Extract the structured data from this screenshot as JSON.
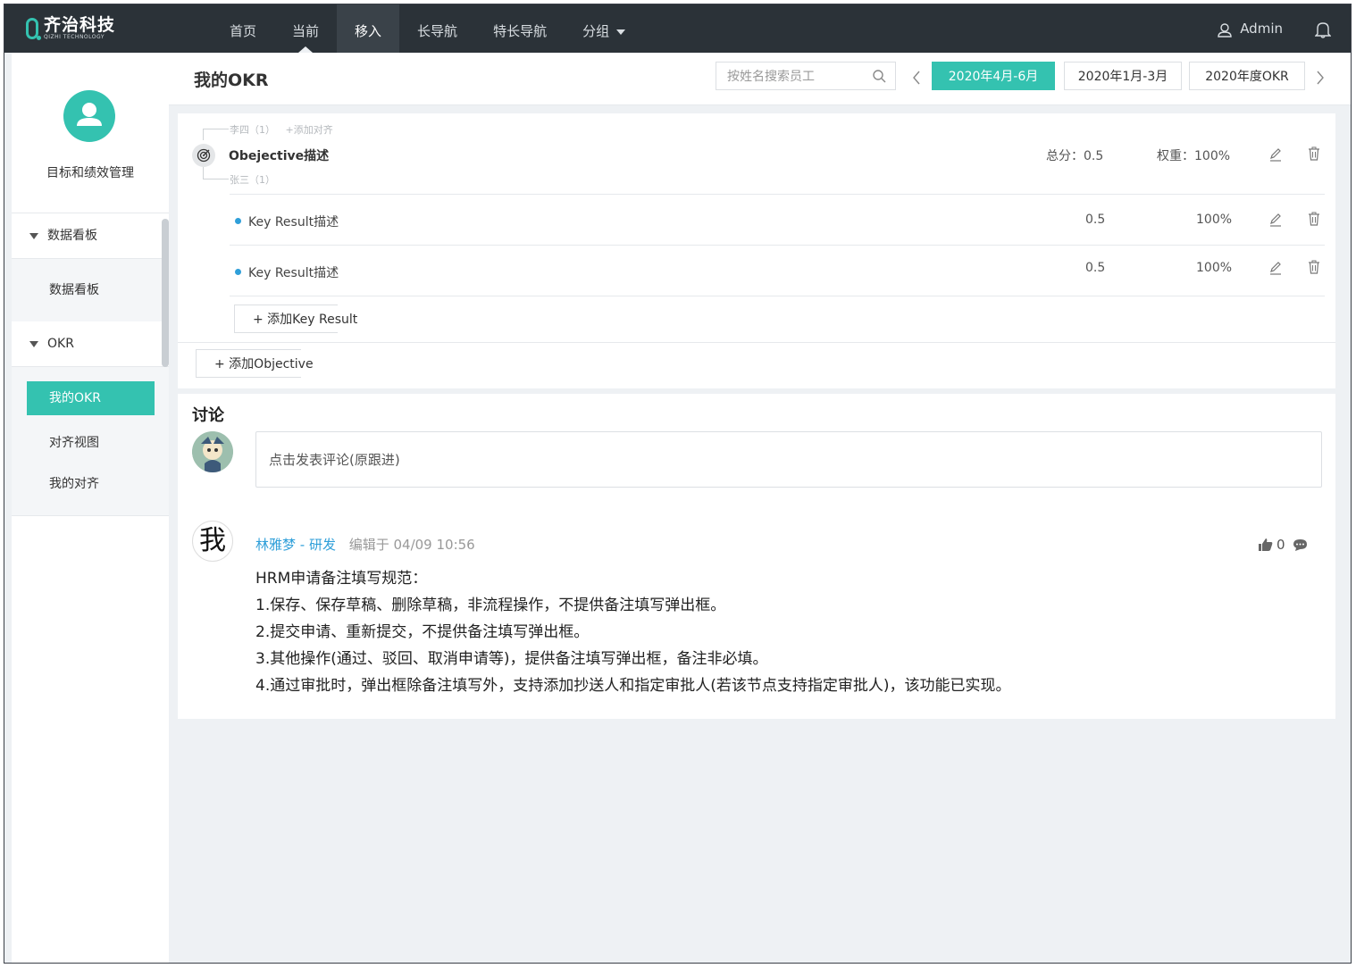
{
  "brand": {
    "name_cn": "齐治科技",
    "name_en": "QIZHI TECHNOLOGY",
    "accent": "#34c2b0",
    "link": "#2f9fd9",
    "topbar": "#2b3238"
  },
  "nav": [
    {
      "label": "首页",
      "state": ""
    },
    {
      "label": "当前",
      "state": "current"
    },
    {
      "label": "移入",
      "state": "active"
    },
    {
      "label": "长导航",
      "state": ""
    },
    {
      "label": "特长导航",
      "state": ""
    },
    {
      "label": "分组",
      "state": "dropdown"
    }
  ],
  "user": {
    "name": "Admin"
  },
  "sidebar": {
    "title": "目标和绩效管理",
    "groups": [
      {
        "label": "数据看板",
        "items": [
          "数据看板"
        ]
      },
      {
        "label": "OKR",
        "items": [
          "我的OKR",
          "对齐视图",
          "我的对齐"
        ]
      }
    ]
  },
  "header": {
    "title": "我的OKR",
    "search_placeholder": "按姓名搜索员工",
    "periods": [
      "2020年4月-6月",
      "2020年1月-3月",
      "2020年度OKR"
    ],
    "selected_period": "2020年4月-6月"
  },
  "okr": {
    "objective": {
      "align_top": "李四（1）",
      "align_add": "+添加对齐",
      "align_bottom": "张三（1）",
      "title": "Obejective描述",
      "score": "总分：0.5",
      "weight": "权重：100%"
    },
    "key_results": [
      {
        "title": "Key  Result描述",
        "score": "0.5",
        "weight": "100%"
      },
      {
        "title": "Key  Result描述",
        "score": "0.5",
        "weight": "100%"
      }
    ],
    "add_kr": "+  添加Key Result",
    "add_objective": "+  添加Objective"
  },
  "discussion": {
    "title": "讨论",
    "input_placeholder": "点击发表评论(原跟进)",
    "posts": [
      {
        "avatar_char": "我",
        "author": "林雅梦 - 研发",
        "edited": "编辑于 04/09 10:56",
        "likes": "0",
        "lines": [
          "HRM申请备注填写规范：",
          "1.保存、保存草稿、删除草稿，非流程操作，不提供备注填写弹出框。",
          "2.提交申请、重新提交，不提供备注填写弹出框。",
          "3.其他操作(通过、驳回、取消申请等)，提供备注填写弹出框，备注非必填。",
          "4.通过审批时，弹出框除备注填写外，支持添加抄送人和指定审批人(若该节点支持指定审批人)，该功能已实现。"
        ]
      }
    ]
  }
}
